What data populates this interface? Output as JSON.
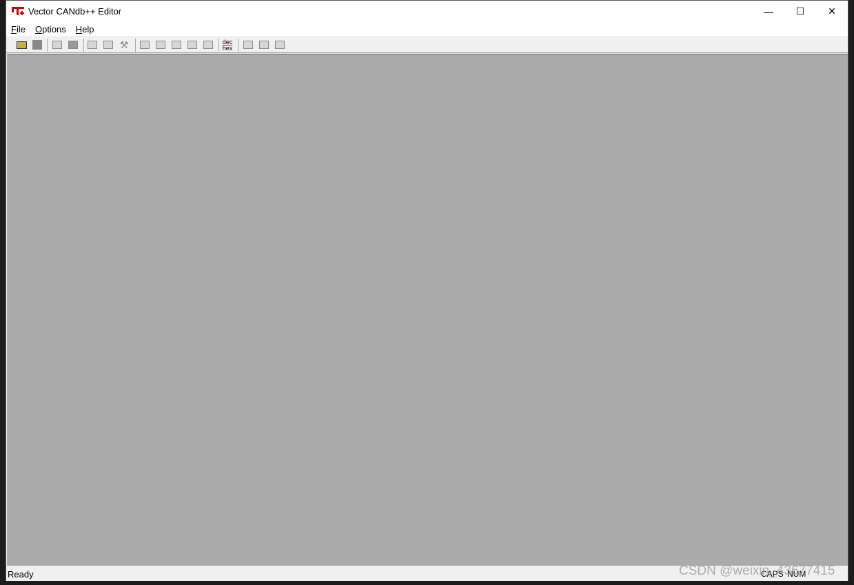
{
  "window": {
    "title": "Vector CANdb++ Editor"
  },
  "menu": [
    {
      "label": "File",
      "key": "F",
      "rest": "ile"
    },
    {
      "label": "Options",
      "key": "O",
      "rest": "ptions"
    },
    {
      "label": "Help",
      "key": "H",
      "rest": "elp"
    }
  ],
  "toolbar": [
    "open-icon",
    "save-icon",
    "copy-icon",
    "paste-icon",
    "properties-icon",
    "edit-icon",
    "tools-icon",
    "view1-icon",
    "view2-icon",
    "view3-icon",
    "view4-icon",
    "view5-icon",
    "dec-hex-icon",
    "cascade-icon",
    "tile-horizontal-icon",
    "tile-vertical-icon"
  ],
  "dechex": {
    "top": "dec",
    "bottom": "hex"
  },
  "status": {
    "text": "Ready",
    "caps": "CAPS",
    "num": "NUM"
  },
  "watermark": "CSDN @weixin_43677415",
  "colors": {
    "workspace": "#ababab",
    "chrome": "#f0f0f0",
    "icon_red": "#cc0000"
  }
}
